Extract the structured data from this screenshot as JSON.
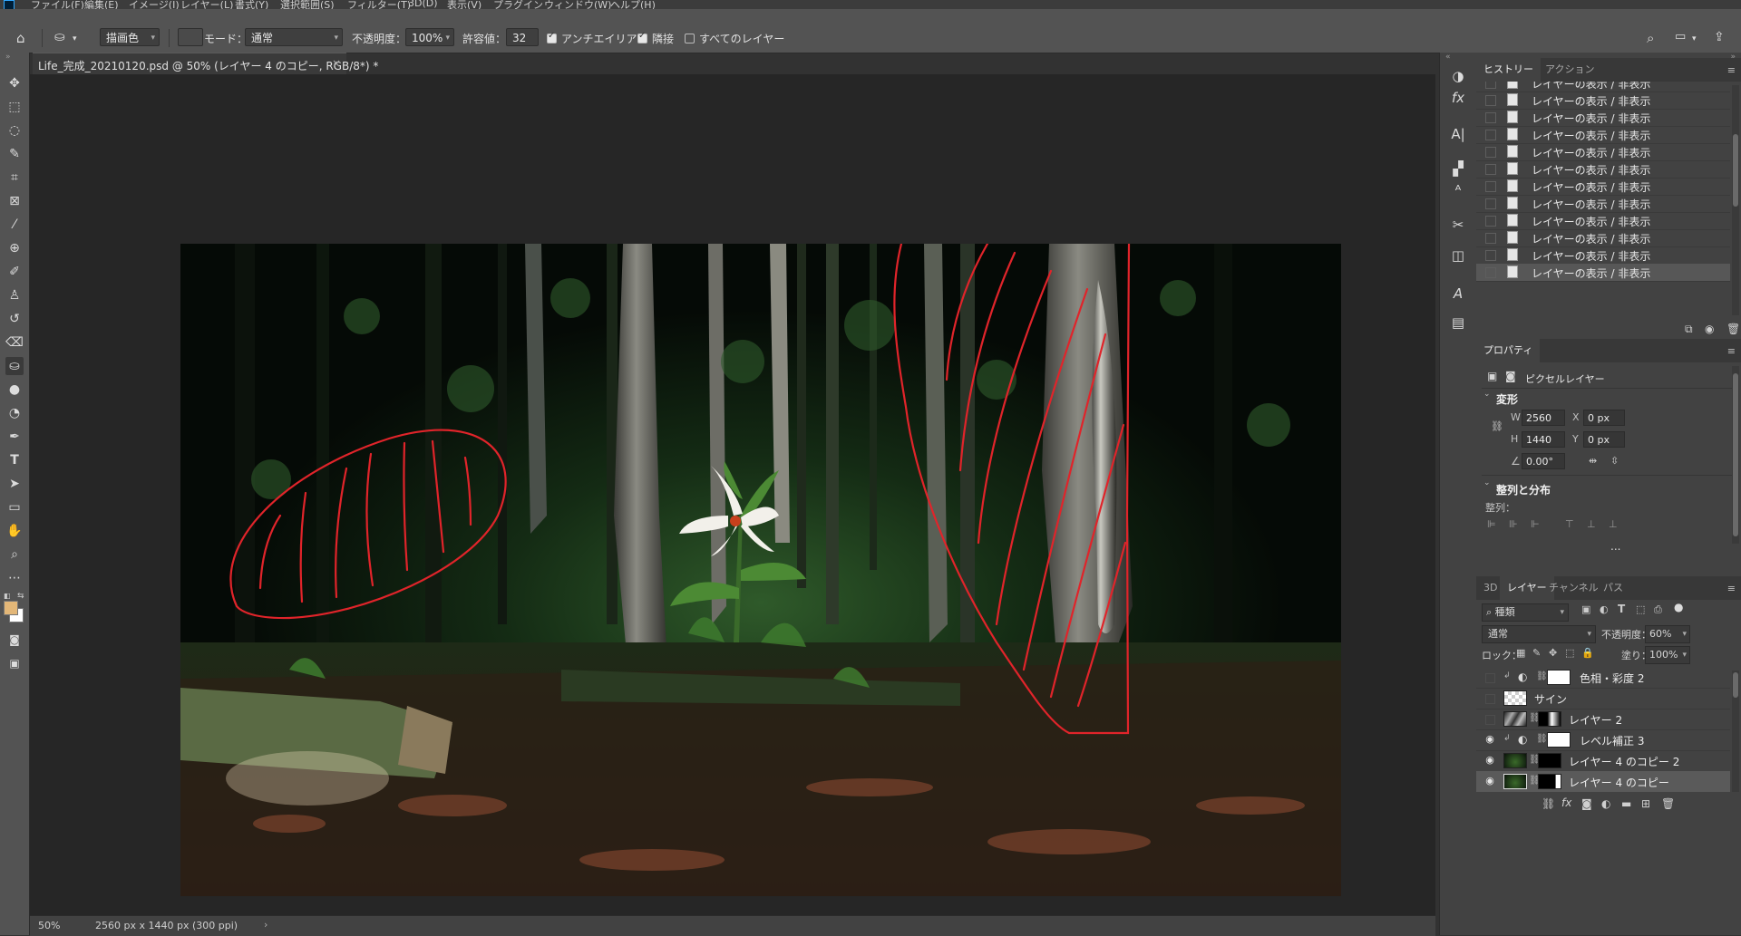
{
  "menu": [
    "ファイル(F)",
    "編集(E)",
    "イメージ(I)",
    "レイヤー(L)",
    "書式(Y)",
    "選択範囲(S)",
    "フィルター(T)",
    "3D(D)",
    "表示(V)",
    "プラグイン",
    "ウィンドウ(W)",
    "ヘルプ(H)"
  ],
  "options": {
    "fill_source": "描画色",
    "mode_label": "モード：",
    "mode_value": "通常",
    "opacity_label": "不透明度：",
    "opacity_value": "100%",
    "tolerance_label": "許容値：",
    "tolerance_value": "32",
    "antialias_label": "アンチエイリアス",
    "antialias_checked": true,
    "contiguous_label": "隣接",
    "contiguous_checked": true,
    "all_layers_label": "すべてのレイヤー",
    "all_layers_checked": false
  },
  "document": {
    "tab_title": "Life_完成_20210120.psd @ 50% (レイヤー 4 のコピー, RGB/8*) *",
    "close_glyph": "×",
    "zoom": "50%",
    "doc_info": "2560 px x 1440 px (300 ppi)",
    "status_arrow": "›"
  },
  "colors": {
    "foreground": "#e3b778",
    "background": "#ffffff",
    "annotation_stroke": "#e0242a"
  },
  "history": {
    "tab_active": "ヒストリー",
    "tab_other": "アクション",
    "items": [
      "レイヤーの表示 / 非表示",
      "レイヤーの表示 / 非表示",
      "レイヤーの表示 / 非表示",
      "レイヤーの表示 / 非表示",
      "レイヤーの表示 / 非表示",
      "レイヤーの表示 / 非表示",
      "レイヤーの表示 / 非表示",
      "レイヤーの表示 / 非表示",
      "レイヤーの表示 / 非表示",
      "レイヤーの表示 / 非表示",
      "レイヤーの表示 / 非表示",
      "レイヤーの表示 / 非表示"
    ]
  },
  "properties": {
    "tab": "プロパティ",
    "layer_type": "ピクセルレイヤー",
    "transform_section": "変形",
    "w_label": "W",
    "w_value": "2560 px",
    "h_label": "H",
    "h_value": "1440 px",
    "x_label": "X",
    "x_value": "0 px",
    "y_label": "Y",
    "y_value": "0 px",
    "angle_value": "0.00°",
    "align_section": "整列と分布",
    "align_label": "整列：",
    "more": "..."
  },
  "layers_panel": {
    "tabs": [
      "3D",
      "レイヤー",
      "チャンネル",
      "パス"
    ],
    "active_tab": "レイヤー",
    "filter_kind": "種類",
    "blend_mode": "通常",
    "opacity_label": "不透明度：",
    "opacity_value": "60%",
    "lock_label": "ロック：",
    "fill_label": "塗り：",
    "fill_value": "100%",
    "layers": [
      {
        "name": "色相・彩度 2",
        "visible": false,
        "selected": false
      },
      {
        "name": "サイン",
        "visible": false,
        "selected": false
      },
      {
        "name": "レイヤー 2",
        "visible": false,
        "selected": false
      },
      {
        "name": "レベル補正 3",
        "visible": true,
        "selected": false
      },
      {
        "name": "レイヤー 4 のコピー 2",
        "visible": true,
        "selected": false
      },
      {
        "name": "レイヤー 4 のコピー",
        "visible": true,
        "selected": true
      }
    ]
  },
  "icons": {
    "home": "home-icon",
    "bucket": "paint-bucket-icon",
    "search": "search-icon",
    "workspace": "workspace-icon",
    "share": "share-icon"
  }
}
